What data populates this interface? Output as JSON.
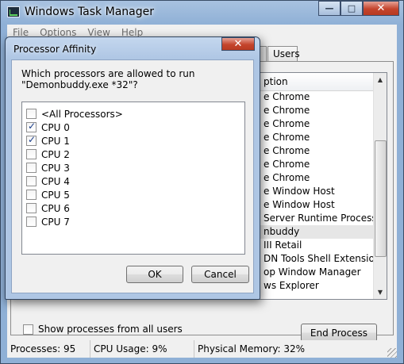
{
  "window": {
    "title": "Windows Task Manager",
    "minimize_glyph": "—",
    "maximize_glyph": "□",
    "close_glyph": "✕"
  },
  "menu": [
    "File",
    "Options",
    "View",
    "Help"
  ],
  "tabs": {
    "users": "Users"
  },
  "process_list": {
    "column_header_fragment": "ption",
    "rows": [
      "e Chrome",
      "e Chrome",
      "e Chrome",
      "e Chrome",
      "e Chrome",
      "e Chrome",
      "e Chrome",
      "e Window Host",
      "e Window Host",
      "Server Runtime Process",
      "nbuddy",
      "III Retail",
      "DN Tools Shell Extensio...",
      "op Window Manager",
      "ws Explorer"
    ],
    "selected_index": 10
  },
  "show_all_users_label": "Show processes from all users",
  "end_process_label": "End Process",
  "status": {
    "processes": "Processes: 95",
    "cpu": "CPU Usage: 9%",
    "memory": "Physical Memory: 32%"
  },
  "dialog": {
    "title": "Processor Affinity",
    "question": "Which processors are allowed to run \"Demonbuddy.exe *32\"?",
    "items": [
      {
        "label": "<All Processors>",
        "checked": false
      },
      {
        "label": "CPU 0",
        "checked": true
      },
      {
        "label": "CPU 1",
        "checked": true
      },
      {
        "label": "CPU 2",
        "checked": false
      },
      {
        "label": "CPU 3",
        "checked": false
      },
      {
        "label": "CPU 4",
        "checked": false
      },
      {
        "label": "CPU 5",
        "checked": false
      },
      {
        "label": "CPU 6",
        "checked": false
      },
      {
        "label": "CPU 7",
        "checked": false
      }
    ],
    "ok_label": "OK",
    "cancel_label": "Cancel"
  }
}
